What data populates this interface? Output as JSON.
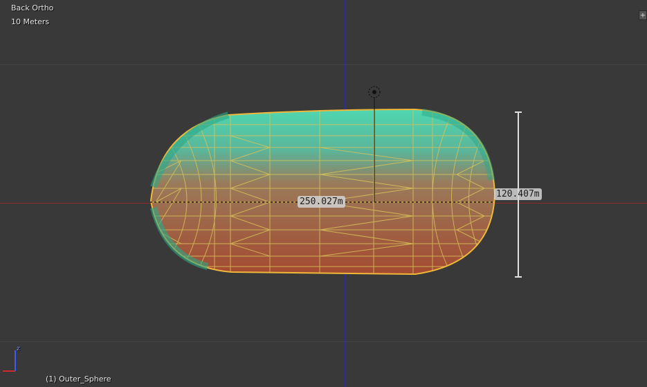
{
  "viewport": {
    "view_name": "Back Ortho",
    "scale_label": "10 Meters",
    "object_label": "(1) Outer_Sphere"
  },
  "measurements": {
    "width_label": "250.027m",
    "height_label": "120.407m"
  },
  "gizmo": {
    "axis_label": "z"
  },
  "colors": {
    "background": "#393939",
    "x_axis": "#8a2a2a",
    "z_axis": "#2d2d9a",
    "wireframe": "#d8c25a",
    "selected_outline": "#f0b83a"
  },
  "icons": {
    "corner_widget": "plus-icon",
    "empty_object": "target-icon"
  }
}
